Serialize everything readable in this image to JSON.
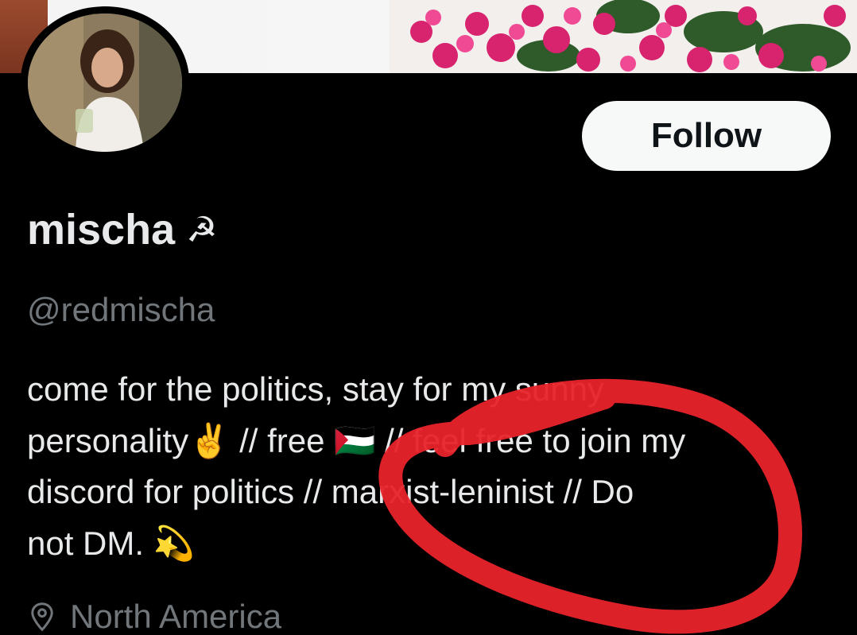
{
  "profile": {
    "follow_label": "Follow",
    "display_name": "mischa",
    "name_emoji": "☭",
    "handle": "@redmischa",
    "bio": "come for the politics, stay for my sunny\npersonality✌️ // free 🇵🇸 // feel free to join my\ndiscord for politics // marxist-leninist // Do\nnot DM. 💫",
    "location": "North America"
  },
  "icons": {
    "location": "location-pin-icon",
    "name_badge": "hammer-sickle-icon"
  },
  "colors": {
    "background": "#000000",
    "primary_text": "#e7e9ea",
    "secondary_text": "#71767b",
    "follow_button_bg": "#f7f9f9",
    "annotation_circle": "#e8232a"
  }
}
